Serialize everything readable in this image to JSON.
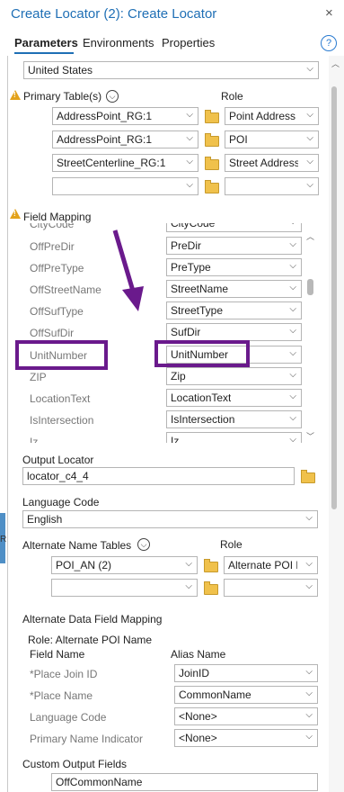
{
  "window": {
    "title": "Create Locator (2): Create Locator",
    "close": "×"
  },
  "tabs": [
    {
      "label": "Parameters"
    },
    {
      "label": "Environments"
    },
    {
      "label": "Properties"
    }
  ],
  "help": "?",
  "country": {
    "value": "United States"
  },
  "primary_tables": {
    "label": "Primary Table(s)",
    "role_label": "Role",
    "rows": [
      {
        "table": "AddressPoint_RG:1",
        "role": "Point Address"
      },
      {
        "table": "AddressPoint_RG:1",
        "role": "POI"
      },
      {
        "table": "StreetCenterline_RG:1",
        "role": "Street Address"
      },
      {
        "table": "",
        "role": ""
      }
    ]
  },
  "field_mapping": {
    "label": "Field Mapping",
    "partial_top": "CityCode",
    "rows": [
      {
        "name": "OffPreDir",
        "value": "PreDir"
      },
      {
        "name": "OffPreType",
        "value": "PreType"
      },
      {
        "name": "OffStreetName",
        "value": "StreetName"
      },
      {
        "name": "OffSufType",
        "value": "StreetType"
      },
      {
        "name": "OffSufDir",
        "value": "SufDir"
      },
      {
        "name": "UnitNumber",
        "value": "UnitNumber"
      },
      {
        "name": "ZIP",
        "value": "Zip"
      },
      {
        "name": "LocationText",
        "value": "LocationText"
      },
      {
        "name": "IsIntersection",
        "value": "IsIntersection"
      },
      {
        "name": "Iz",
        "value": "Iz"
      }
    ]
  },
  "output_locator": {
    "label": "Output Locator",
    "value": "locator_c4_4"
  },
  "language_code": {
    "label": "Language Code",
    "value": "English"
  },
  "alternate_name_tables": {
    "label": "Alternate Name Tables",
    "role_label": "Role",
    "rows": [
      {
        "table": "POI_AN (2)",
        "role": "Alternate POI N"
      },
      {
        "table": "",
        "role": ""
      }
    ]
  },
  "alt_data_field_mapping": {
    "label": "Alternate Data Field Mapping",
    "role_line": "Role: Alternate POI Name",
    "col_field": "Field Name",
    "col_alias": "Alias Name",
    "rows": [
      {
        "name": "*Place Join ID",
        "value": "JoinID"
      },
      {
        "name": "*Place Name",
        "value": "CommonName"
      },
      {
        "name": "Language Code",
        "value": "<None>"
      },
      {
        "name": "Primary Name Indicator",
        "value": "<None>"
      }
    ]
  },
  "custom_output_fields": {
    "label": "Custom Output Fields",
    "value": "OffCommonName"
  },
  "side_fragment": "R",
  "colors": {
    "accent": "#1f6fb5",
    "highlight": "#6a1a8c",
    "warning": "#e3a21a"
  }
}
